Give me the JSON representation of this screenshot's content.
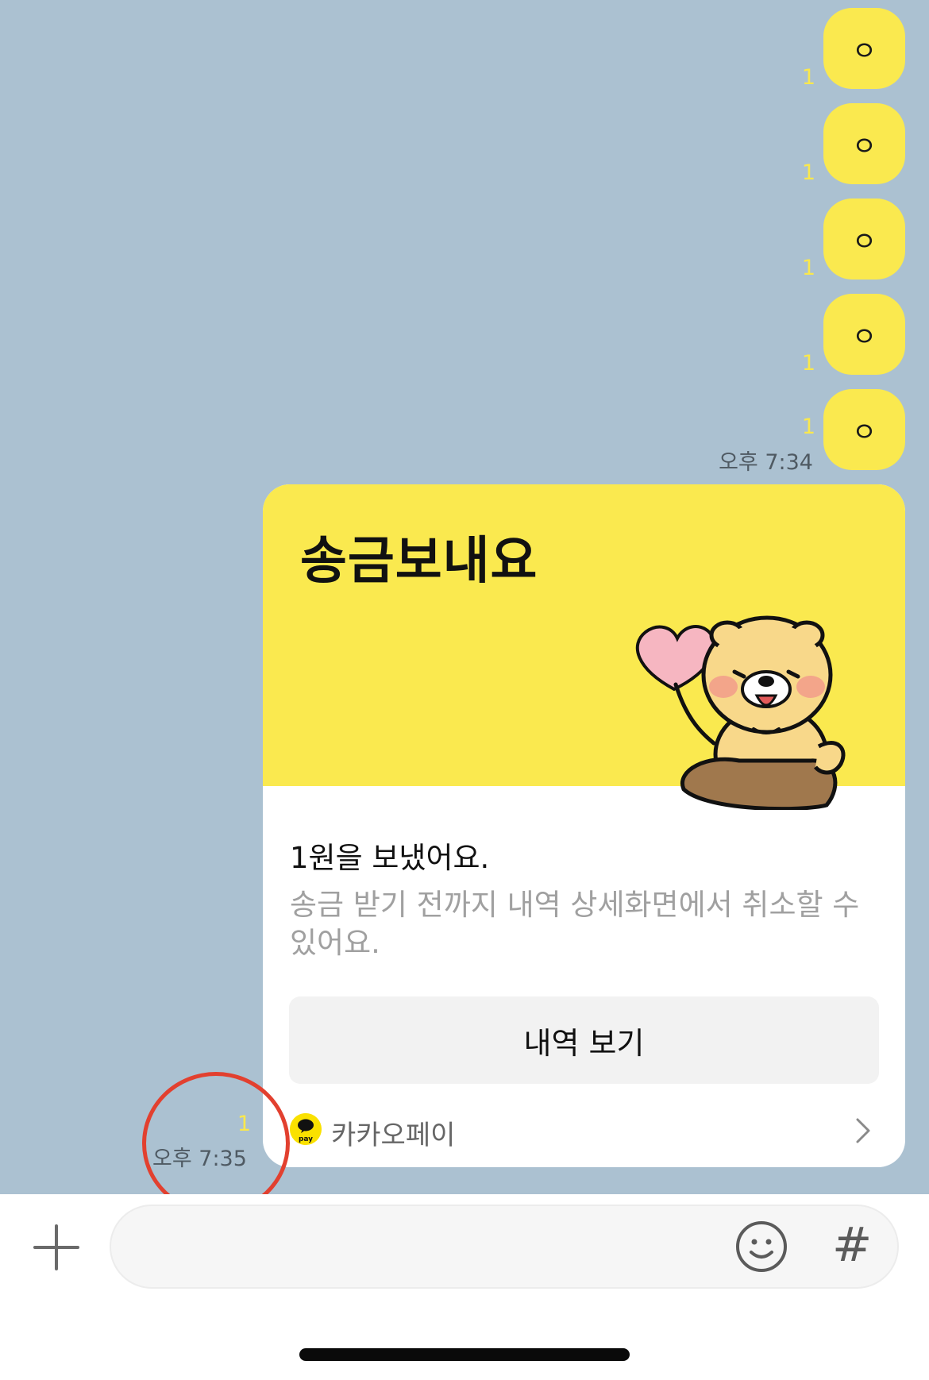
{
  "messages": [
    {
      "text": "ㅇ",
      "unread": "1"
    },
    {
      "text": "ㅇ",
      "unread": "1"
    },
    {
      "text": "ㅇ",
      "unread": "1"
    },
    {
      "text": "ㅇ",
      "unread": "1"
    },
    {
      "text": "ㅇ",
      "unread": "1"
    }
  ],
  "time_734": "오후 7:34",
  "card": {
    "title": "송금보내요",
    "line1": "1원을 보냈어요.",
    "line2": "송금 받기 전까지 내역 상세화면에서 취소할 수 있어요.",
    "button": "내역 보기",
    "provider": "카카오페이",
    "logo_text": "pay"
  },
  "card_meta": {
    "unread": "1",
    "time": "오후 7:35"
  },
  "colors": {
    "chat_bg": "#abc1d1",
    "bubble": "#fae94f",
    "unread": "#fae84c",
    "annotation_circle": "#e2402f"
  },
  "icons": {
    "plus": "plus-icon",
    "emoji": "emoji-icon",
    "hash": "#",
    "chevron": "chevron-right-icon"
  }
}
